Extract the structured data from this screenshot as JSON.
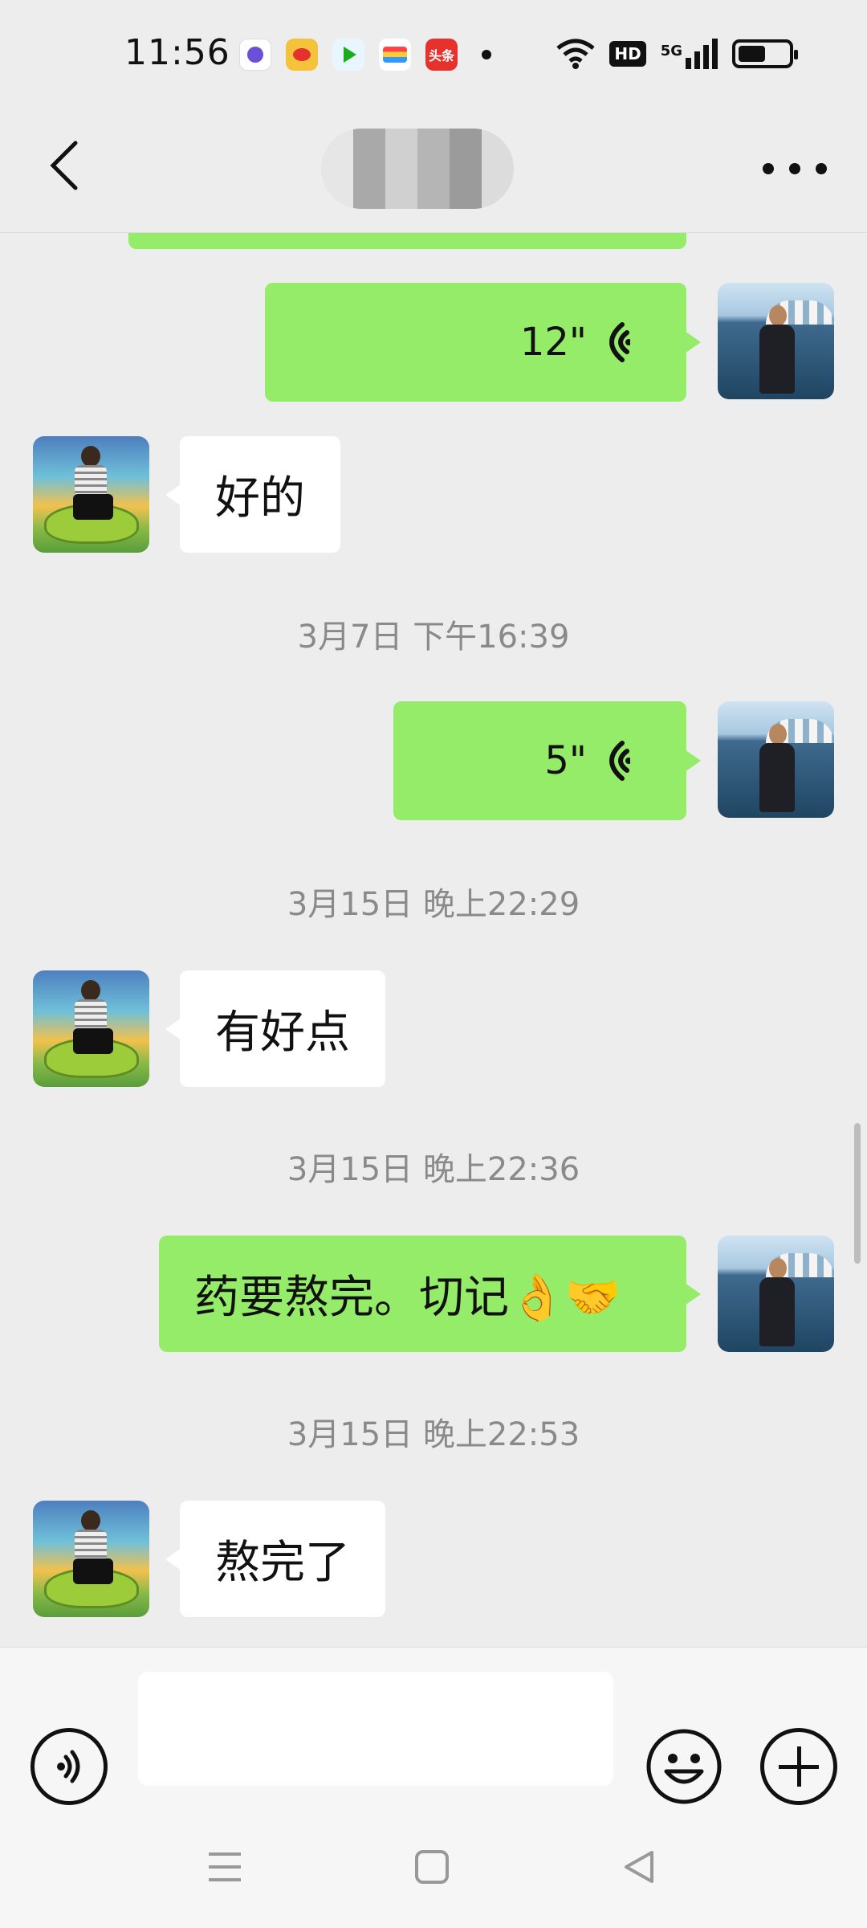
{
  "status_bar": {
    "time": "11:56",
    "network": "5G",
    "hd": "HD",
    "battery_level": 0.55,
    "notification_icons": [
      "chat-app-icon",
      "weibo-icon",
      "video-app-icon",
      "card-app-icon",
      "toutiao-icon"
    ],
    "toutiao_label": "头条"
  },
  "header": {
    "title_obscured": true
  },
  "messages": [
    {
      "side": "out",
      "type": "voice",
      "duration": "12\""
    },
    {
      "side": "in",
      "type": "text",
      "text": "好的"
    },
    {
      "type": "time",
      "text": "3月7日 下午16:39"
    },
    {
      "side": "out",
      "type": "voice",
      "duration": "5\""
    },
    {
      "type": "time",
      "text": "3月15日 晚上22:29"
    },
    {
      "side": "in",
      "type": "text",
      "text": "有好点"
    },
    {
      "type": "time",
      "text": "3月15日 晚上22:36"
    },
    {
      "side": "out",
      "type": "text",
      "text": "药要熬完。切记👌🤝"
    },
    {
      "type": "time",
      "text": "3月15日 晚上22:53"
    },
    {
      "side": "in",
      "type": "text",
      "text": "熬完了"
    }
  ],
  "input": {
    "value": "",
    "placeholder": ""
  },
  "colors": {
    "outgoing_bubble": "#95ec69",
    "incoming_bubble": "#ffffff",
    "background": "#ededed"
  }
}
